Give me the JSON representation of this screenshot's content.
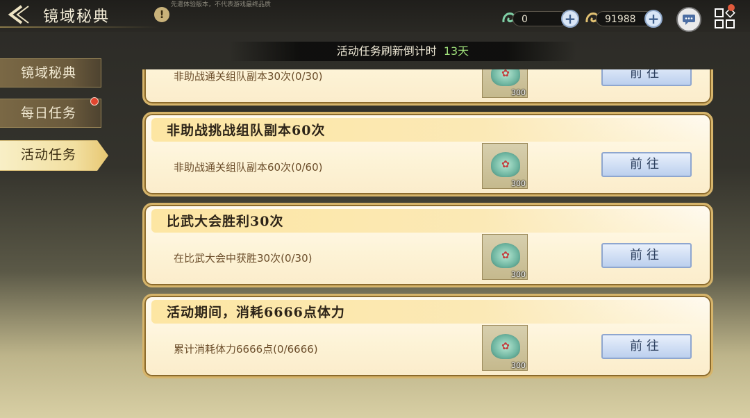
{
  "header": {
    "title": "镜域秘典",
    "back_icon": "back-arrow-icon",
    "info_icon": "info-icon",
    "info_symbol": "!",
    "disclaimer": "先遣体验版本，不代表游戏最终品质"
  },
  "currencies": [
    {
      "icon": "jade-dragon-icon",
      "value": "0"
    },
    {
      "icon": "gold-dragon-icon",
      "value": "91988"
    }
  ],
  "banner": {
    "label": "活动任务刷新倒计时",
    "days": "13天"
  },
  "sidebar": {
    "items": [
      {
        "label": "镜域秘典",
        "active": false,
        "has_notification": false
      },
      {
        "label": "每日任务",
        "active": false,
        "has_notification": true
      },
      {
        "label": "活动任务",
        "active": true,
        "has_notification": false
      }
    ]
  },
  "tasks": [
    {
      "title": "",
      "desc": "非助战通关组队副本30次(0/30)",
      "reward_qty": "300",
      "button": "前往"
    },
    {
      "title": "非助战挑战组队副本60次",
      "desc": "非助战通关组队副本60次(0/60)",
      "reward_qty": "300",
      "button": "前往"
    },
    {
      "title": "比武大会胜利30次",
      "desc": "在比武大会中获胜30次(0/30)",
      "reward_qty": "300",
      "button": "前往"
    },
    {
      "title": "活动期间，消耗6666点体力",
      "desc": "累计消耗体力6666点(0/6666)",
      "reward_qty": "300",
      "button": "前往"
    }
  ],
  "colors": {
    "accent_gold": "#d6b46a",
    "countdown_green": "#9fe07a",
    "button_blue": "#bcd0ee"
  }
}
